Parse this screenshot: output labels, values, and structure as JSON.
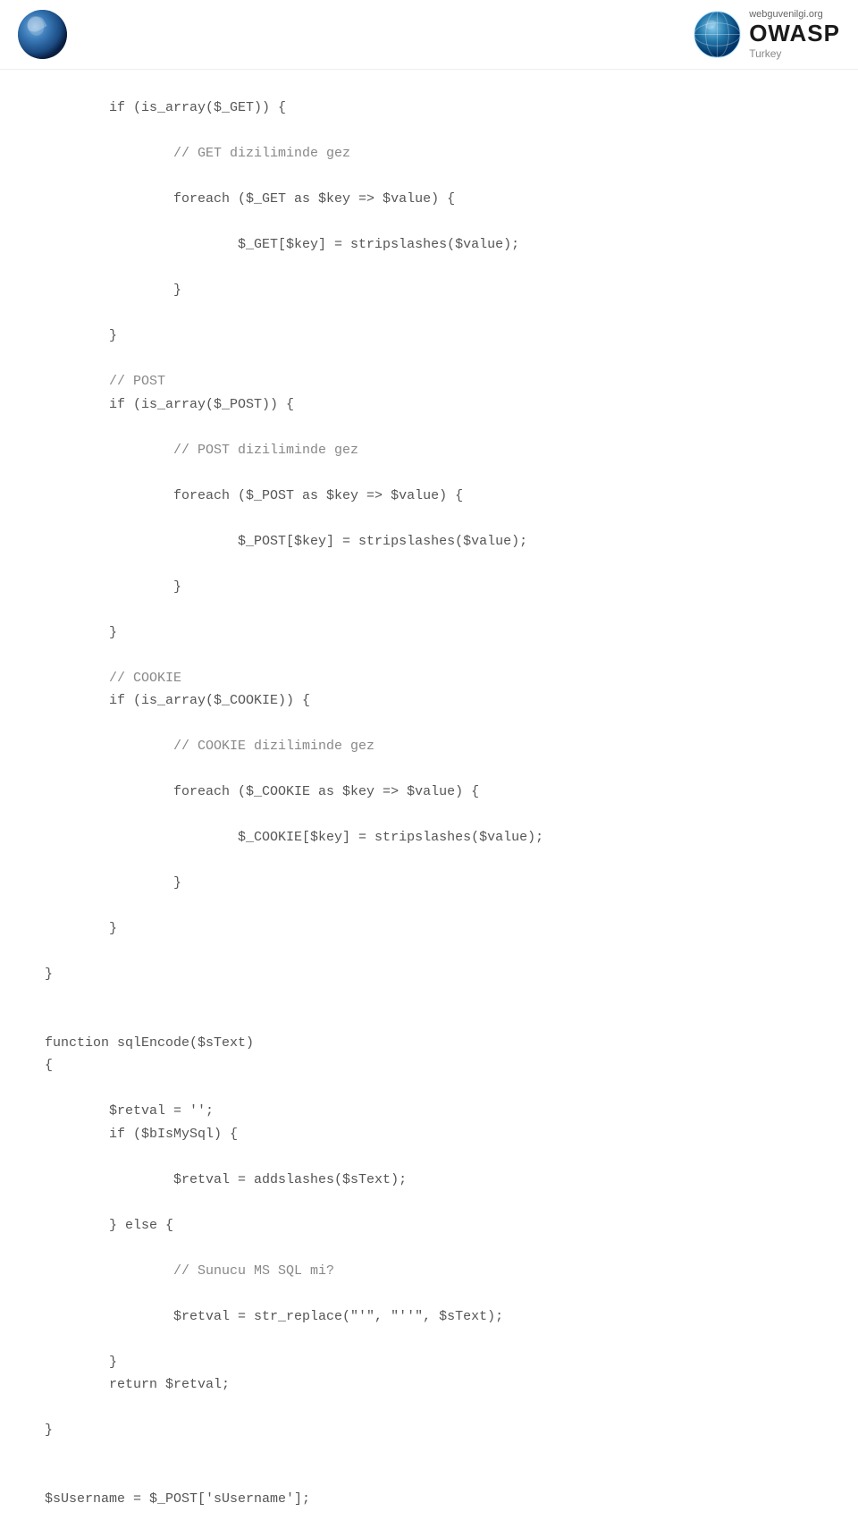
{
  "header": {
    "site_label": "webguvenilgi.org",
    "owasp_label": "OWASP",
    "turkey_label": "Turkey"
  },
  "code": {
    "lines": [
      "        if (is_array($_GET)) {",
      "",
      "                // GET diziliminde gez",
      "",
      "                foreach ($_GET as $key => $value) {",
      "",
      "                        $_GET[$key] = stripslashes($value);",
      "",
      "                }",
      "",
      "        }",
      "",
      "        // POST",
      "        if (is_array($_POST)) {",
      "",
      "                // POST diziliminde gez",
      "",
      "                foreach ($_POST as $key => $value) {",
      "",
      "                        $_POST[$key] = stripslashes($value);",
      "",
      "                }",
      "",
      "        }",
      "",
      "        // COOKIE",
      "        if (is_array($_COOKIE)) {",
      "",
      "                // COOKIE diziliminde gez",
      "",
      "                foreach ($_COOKIE as $key => $value) {",
      "",
      "                        $_COOKIE[$key] = stripslashes($value);",
      "",
      "                }",
      "",
      "        }",
      "",
      "}",
      "",
      "",
      "function sqlEncode($sText)",
      "{",
      "",
      "        $retval = '';",
      "        if ($bIsMySql) {",
      "",
      "                $retval = addslashes($sText);",
      "",
      "        } else {",
      "",
      "                // Sunucu MS SQL mi?",
      "",
      "                $retval = str_replace(\"'\", \"''\", $sText);",
      "",
      "        }",
      "        return $retval;",
      "",
      "}",
      "",
      "",
      "$sUsername = $_POST['sUsername'];"
    ]
  }
}
